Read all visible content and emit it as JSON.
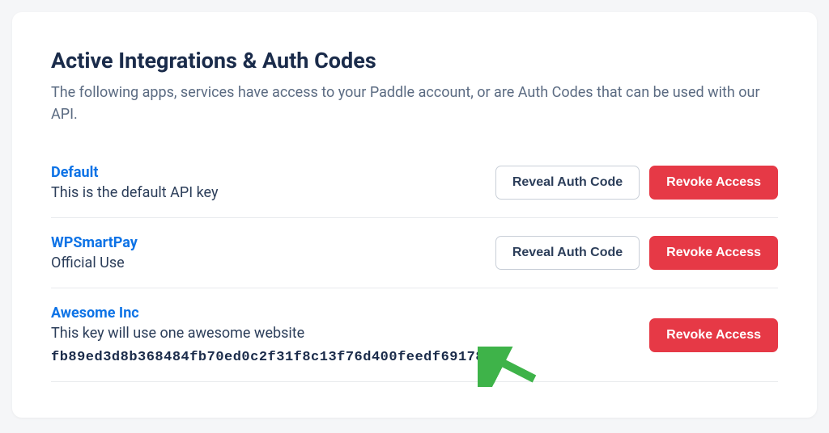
{
  "header": {
    "title": "Active Integrations & Auth Codes",
    "description": "The following apps, services have access to your Paddle account, or are Auth Codes that can be used with our API."
  },
  "buttons": {
    "reveal": "Reveal Auth Code",
    "revoke": "Revoke Access"
  },
  "integrations": [
    {
      "name": "Default",
      "description": "This is the default API key",
      "showReveal": true,
      "code": null
    },
    {
      "name": "WPSmartPay",
      "description": "Official Use",
      "showReveal": true,
      "code": null
    },
    {
      "name": "Awesome Inc",
      "description": "This key will use one awesome website",
      "showReveal": false,
      "code": "fb89ed3d8b368484fb70ed0c2f31f8c13f76d400feedf69178"
    }
  ]
}
